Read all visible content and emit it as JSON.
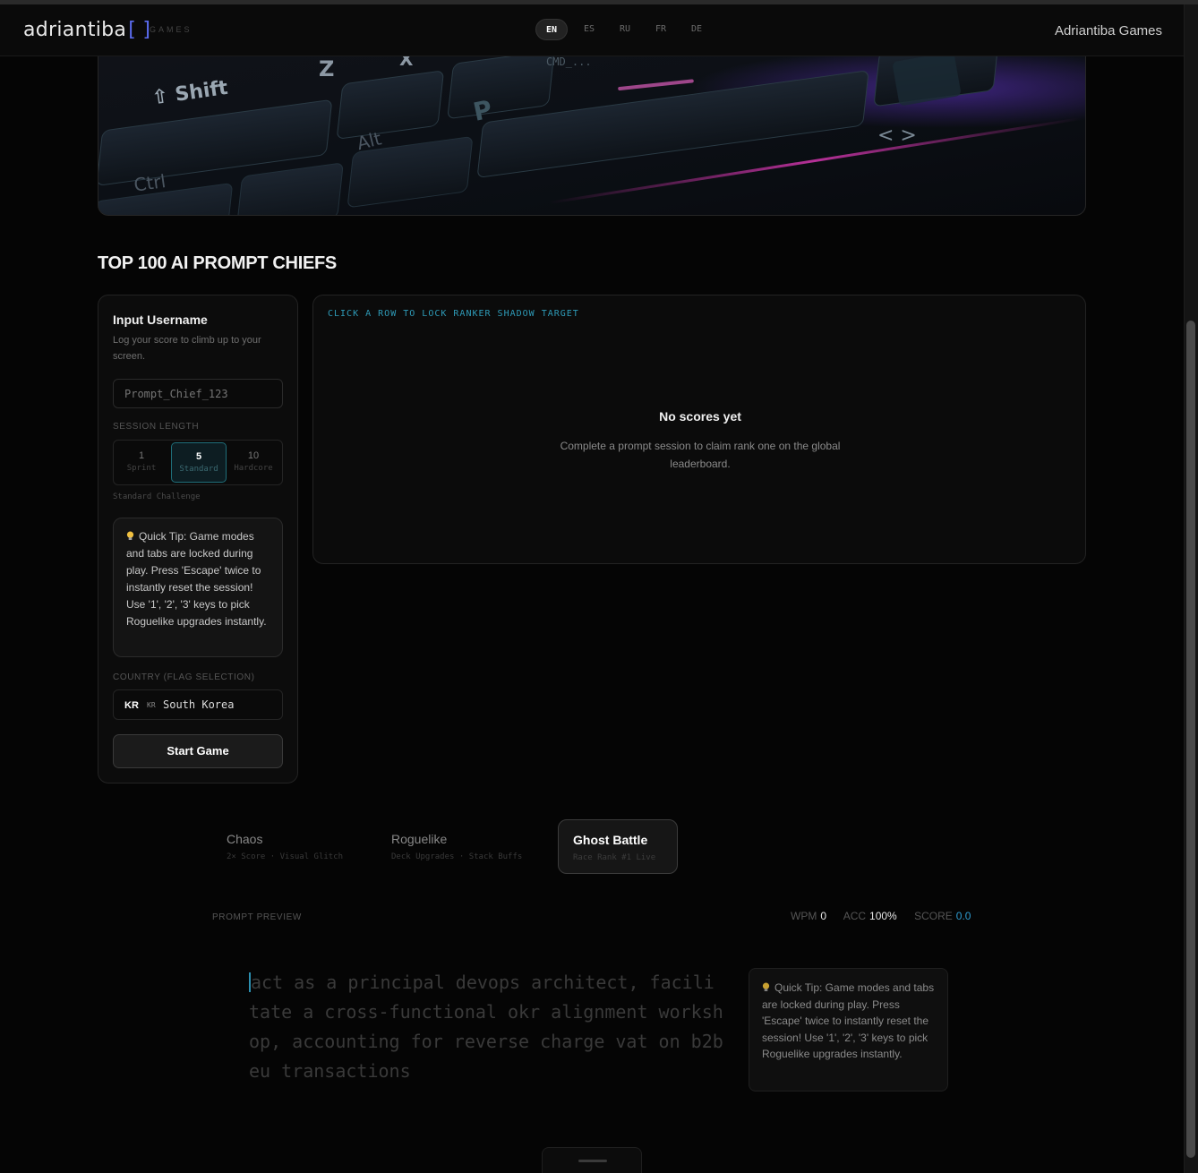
{
  "header": {
    "logo_text": "adriantiba",
    "logo_bracket": "[ ]",
    "logo_sub": "GAMES",
    "languages": [
      {
        "code": "EN",
        "active": true
      },
      {
        "code": "ES",
        "active": false
      },
      {
        "code": "RU",
        "active": false
      },
      {
        "code": "FR",
        "active": false
      },
      {
        "code": "DE",
        "active": false
      }
    ],
    "brand": "Adriantiba Games"
  },
  "hero": {
    "keycaps": [
      "Shift",
      "Z",
      "X",
      "Ctrl",
      "Alt",
      "P",
      "< >",
      "CMD_..."
    ]
  },
  "leaderboard": {
    "title": "TOP 100 AI PROMPT CHIEFS",
    "hint": "CLICK A ROW TO LOCK RANKER SHADOW TARGET",
    "empty_title": "No scores yet",
    "empty_desc": "Complete a prompt session to claim rank one on the global leaderboard."
  },
  "form": {
    "title": "Input Username",
    "desc": "Log your score to climb up to your screen.",
    "username_placeholder": "Prompt_Chief_123",
    "session_label": "SESSION LENGTH",
    "session_options": [
      {
        "num": "1",
        "sub": "Sprint",
        "active": false
      },
      {
        "num": "5",
        "sub": "Standard",
        "active": true
      },
      {
        "num": "10",
        "sub": "Hardcore",
        "active": false
      }
    ],
    "session_caption": "Standard Challenge",
    "tip": "Quick Tip: Game modes and tabs are locked during play. Press 'Escape' twice to instantly reset the session! Use '1', '2', '3' keys to pick Roguelike upgrades instantly.",
    "country_label": "COUNTRY (FLAG SELECTION)",
    "country_flag": "KR",
    "country_code": "KR",
    "country_name": "South Korea",
    "start_label": "Start Game"
  },
  "modes": [
    {
      "title": "Chaos",
      "sub": "2× Score · Visual Glitch",
      "active": false
    },
    {
      "title": "Roguelike",
      "sub": "Deck Upgrades · Stack Buffs",
      "active": false
    },
    {
      "title": "Ghost Battle",
      "sub": "Race Rank #1 Live",
      "active": true
    }
  ],
  "preview": {
    "label": "PROMPT PREVIEW",
    "wpm_label": "WPM",
    "wpm": "0",
    "acc_label": "ACC",
    "acc": "100%",
    "score_label": "SCORE",
    "score": "0.0",
    "prompt_first": "a",
    "prompt_rest": "ct as a principal devops architect, facilitate a cross-functional okr alignment workshop, accounting for reverse charge vat on b2b eu transactions",
    "tip": "Quick Tip: Game modes and tabs are locked during play. Press 'Escape' twice to instantly reset the session! Use '1', '2', '3' keys to pick Roguelike upgrades instantly."
  },
  "colors": {
    "accent": "#2e9bd0",
    "logo_accent": "#5b6cf0",
    "active_session": "#1f6e7a"
  }
}
